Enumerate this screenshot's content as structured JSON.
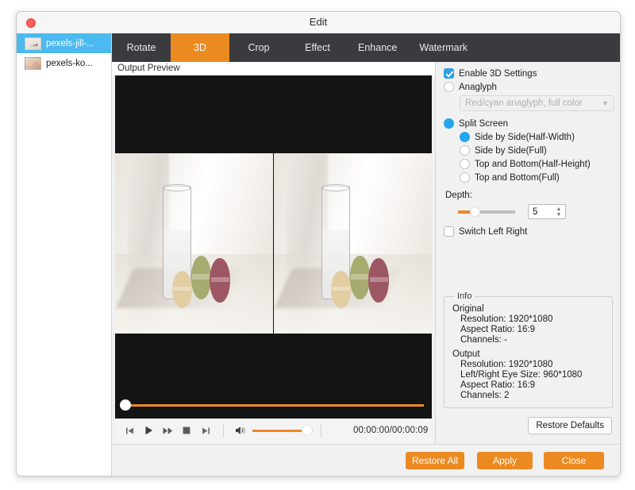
{
  "window": {
    "title": "Edit",
    "close_button": "close-traffic-light"
  },
  "sidebar": {
    "files": [
      {
        "name": "pexels-jill-...",
        "selected": true
      },
      {
        "name": "pexels-ko...",
        "selected": false
      }
    ]
  },
  "tabs": [
    {
      "label": "Rotate",
      "active": false
    },
    {
      "label": "3D",
      "active": true
    },
    {
      "label": "Crop",
      "active": false
    },
    {
      "label": "Effect",
      "active": false
    },
    {
      "label": "Enhance",
      "active": false
    },
    {
      "label": "Watermark",
      "active": false
    }
  ],
  "preview": {
    "label": "Output Preview",
    "seek_position_percent": 0
  },
  "transport": {
    "buttons": [
      "previous-icon",
      "play-icon",
      "fast-forward-icon",
      "stop-icon",
      "next-icon"
    ],
    "volume_icon": "speaker-icon",
    "volume_percent": 100,
    "timecode": "00:00:00/00:00:09"
  },
  "settings": {
    "enable_3d": {
      "label": "Enable 3D Settings",
      "checked": true
    },
    "anaglyph": {
      "label": "Anaglyph",
      "selected": false
    },
    "anaglyph_select": {
      "value": "Red/cyan anaglyph, full color",
      "disabled": true,
      "chevron": "chevron-down-icon"
    },
    "split_screen": {
      "label": "Split Screen",
      "selected": true
    },
    "split_options": [
      {
        "label": "Side by Side(Half-Width)",
        "selected": true
      },
      {
        "label": "Side by Side(Full)",
        "selected": false
      },
      {
        "label": "Top and Bottom(Half-Height)",
        "selected": false
      },
      {
        "label": "Top and Bottom(Full)",
        "selected": false
      }
    ],
    "depth": {
      "label": "Depth:",
      "value": "5",
      "slider_percent": 22
    },
    "switch_left_right": {
      "label": "Switch Left Right",
      "checked": false
    }
  },
  "info": {
    "legend": "Info",
    "original_heading": "Original",
    "original": [
      "Resolution: 1920*1080",
      "Aspect Ratio: 16:9",
      "Channels: -"
    ],
    "output_heading": "Output",
    "output": [
      "Resolution: 1920*1080",
      "Left/Right Eye Size: 960*1080",
      "Aspect Ratio: 16:9",
      "Channels: 2"
    ]
  },
  "buttons": {
    "restore_defaults": "Restore Defaults",
    "restore_all": "Restore All",
    "apply": "Apply",
    "close": "Close"
  },
  "colors": {
    "accent_orange": "#ec8a22",
    "selection_blue": "#4cb9ef",
    "control_blue": "#25a6ec",
    "tabbar_dark": "#3b3b3f"
  }
}
